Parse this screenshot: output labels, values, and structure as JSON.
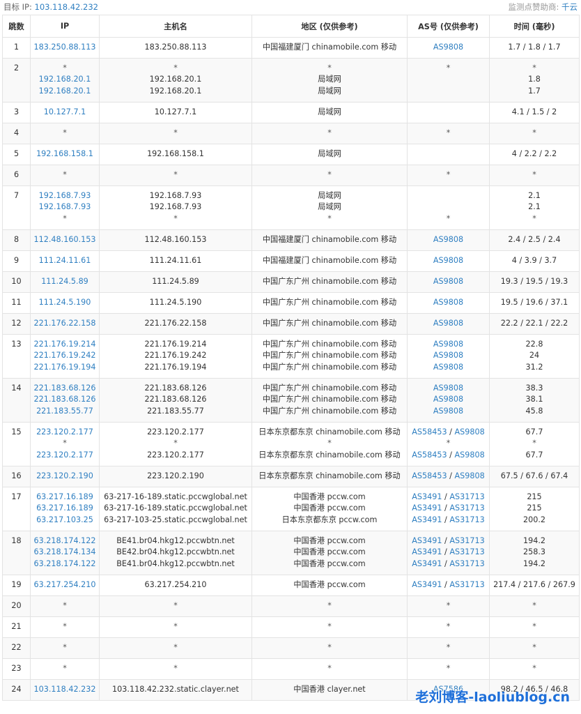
{
  "header": {
    "target_label": "目标 IP:",
    "target_ip": "103.118.42.232",
    "sponsor_label": "监测点赞助商:",
    "sponsor_name": "千云"
  },
  "columns": [
    "跳数",
    "IP",
    "主机名",
    "地区 (仅供参考)",
    "AS号 (仅供参考)",
    "时间 (毫秒)"
  ],
  "rows": [
    {
      "hop": "1",
      "ips": [
        "183.250.88.113"
      ],
      "hosts": [
        "183.250.88.113"
      ],
      "regions": [
        "中国福建厦门 chinamobile.com 移动"
      ],
      "as": [
        [
          "AS9808"
        ]
      ],
      "times": [
        "1.7 / 1.8 / 1.7"
      ]
    },
    {
      "hop": "2",
      "ips": [
        "*",
        "192.168.20.1",
        "192.168.20.1"
      ],
      "hosts": [
        "*",
        "192.168.20.1",
        "192.168.20.1"
      ],
      "regions": [
        "*",
        "局域网",
        "局域网"
      ],
      "as": [
        [
          "*"
        ],
        [],
        []
      ],
      "times": [
        "*",
        "1.8",
        "1.7"
      ]
    },
    {
      "hop": "3",
      "ips": [
        "10.127.7.1"
      ],
      "hosts": [
        "10.127.7.1"
      ],
      "regions": [
        "局域网"
      ],
      "as": [
        []
      ],
      "times": [
        "4.1 / 1.5 / 2"
      ]
    },
    {
      "hop": "4",
      "ips": [
        "*"
      ],
      "hosts": [
        "*"
      ],
      "regions": [
        "*"
      ],
      "as": [
        [
          "*"
        ]
      ],
      "times": [
        "*"
      ]
    },
    {
      "hop": "5",
      "ips": [
        "192.168.158.1"
      ],
      "hosts": [
        "192.168.158.1"
      ],
      "regions": [
        "局域网"
      ],
      "as": [
        []
      ],
      "times": [
        "4 / 2.2 / 2.2"
      ]
    },
    {
      "hop": "6",
      "ips": [
        "*"
      ],
      "hosts": [
        "*"
      ],
      "regions": [
        "*"
      ],
      "as": [
        [
          "*"
        ]
      ],
      "times": [
        "*"
      ]
    },
    {
      "hop": "7",
      "ips": [
        "192.168.7.93",
        "192.168.7.93",
        "*"
      ],
      "hosts": [
        "192.168.7.93",
        "192.168.7.93",
        "*"
      ],
      "regions": [
        "局域网",
        "局域网",
        "*"
      ],
      "as": [
        [],
        [],
        [
          "*"
        ]
      ],
      "times": [
        "2.1",
        "2.1",
        "*"
      ]
    },
    {
      "hop": "8",
      "ips": [
        "112.48.160.153"
      ],
      "hosts": [
        "112.48.160.153"
      ],
      "regions": [
        "中国福建厦门 chinamobile.com 移动"
      ],
      "as": [
        [
          "AS9808"
        ]
      ],
      "times": [
        "2.4 / 2.5 / 2.4"
      ]
    },
    {
      "hop": "9",
      "ips": [
        "111.24.11.61"
      ],
      "hosts": [
        "111.24.11.61"
      ],
      "regions": [
        "中国福建厦门 chinamobile.com 移动"
      ],
      "as": [
        [
          "AS9808"
        ]
      ],
      "times": [
        "4 / 3.9 / 3.7"
      ]
    },
    {
      "hop": "10",
      "ips": [
        "111.24.5.89"
      ],
      "hosts": [
        "111.24.5.89"
      ],
      "regions": [
        "中国广东广州 chinamobile.com 移动"
      ],
      "as": [
        [
          "AS9808"
        ]
      ],
      "times": [
        "19.3 / 19.5 / 19.3"
      ]
    },
    {
      "hop": "11",
      "ips": [
        "111.24.5.190"
      ],
      "hosts": [
        "111.24.5.190"
      ],
      "regions": [
        "中国广东广州 chinamobile.com 移动"
      ],
      "as": [
        [
          "AS9808"
        ]
      ],
      "times": [
        "19.5 / 19.6 / 37.1"
      ]
    },
    {
      "hop": "12",
      "ips": [
        "221.176.22.158"
      ],
      "hosts": [
        "221.176.22.158"
      ],
      "regions": [
        "中国广东广州 chinamobile.com 移动"
      ],
      "as": [
        [
          "AS9808"
        ]
      ],
      "times": [
        "22.2 / 22.1 / 22.2"
      ]
    },
    {
      "hop": "13",
      "ips": [
        "221.176.19.214",
        "221.176.19.242",
        "221.176.19.194"
      ],
      "hosts": [
        "221.176.19.214",
        "221.176.19.242",
        "221.176.19.194"
      ],
      "regions": [
        "中国广东广州 chinamobile.com 移动",
        "中国广东广州 chinamobile.com 移动",
        "中国广东广州 chinamobile.com 移动"
      ],
      "as": [
        [
          "AS9808"
        ],
        [
          "AS9808"
        ],
        [
          "AS9808"
        ]
      ],
      "times": [
        "22.8",
        "24",
        "31.2"
      ]
    },
    {
      "hop": "14",
      "ips": [
        "221.183.68.126",
        "221.183.68.126",
        "221.183.55.77"
      ],
      "hosts": [
        "221.183.68.126",
        "221.183.68.126",
        "221.183.55.77"
      ],
      "regions": [
        "中国广东广州 chinamobile.com 移动",
        "中国广东广州 chinamobile.com 移动",
        "中国广东广州 chinamobile.com 移动"
      ],
      "as": [
        [
          "AS9808"
        ],
        [
          "AS9808"
        ],
        [
          "AS9808"
        ]
      ],
      "times": [
        "38.3",
        "38.1",
        "45.8"
      ]
    },
    {
      "hop": "15",
      "ips": [
        "223.120.2.177",
        "*",
        "223.120.2.177"
      ],
      "hosts": [
        "223.120.2.177",
        "*",
        "223.120.2.177"
      ],
      "regions": [
        "日本东京都东京 chinamobile.com 移动",
        "*",
        "日本东京都东京 chinamobile.com 移动"
      ],
      "as": [
        [
          "AS58453",
          "AS9808"
        ],
        [
          "*"
        ],
        [
          "AS58453",
          "AS9808"
        ]
      ],
      "times": [
        "67.7",
        "*",
        "67.7"
      ]
    },
    {
      "hop": "16",
      "ips": [
        "223.120.2.190"
      ],
      "hosts": [
        "223.120.2.190"
      ],
      "regions": [
        "日本东京都东京 chinamobile.com 移动"
      ],
      "as": [
        [
          "AS58453",
          "AS9808"
        ]
      ],
      "times": [
        "67.5 / 67.6 / 67.4"
      ]
    },
    {
      "hop": "17",
      "ips": [
        "63.217.16.189",
        "63.217.16.189",
        "63.217.103.25"
      ],
      "hosts": [
        "63-217-16-189.static.pccwglobal.net",
        "63-217-16-189.static.pccwglobal.net",
        "63-217-103-25.static.pccwglobal.net"
      ],
      "regions": [
        "中国香港 pccw.com",
        "中国香港 pccw.com",
        "日本东京都东京 pccw.com"
      ],
      "as": [
        [
          "AS3491",
          "AS31713"
        ],
        [
          "AS3491",
          "AS31713"
        ],
        [
          "AS3491",
          "AS31713"
        ]
      ],
      "times": [
        "215",
        "215",
        "200.2"
      ]
    },
    {
      "hop": "18",
      "ips": [
        "63.218.174.122",
        "63.218.174.134",
        "63.218.174.122"
      ],
      "hosts": [
        "BE41.br04.hkg12.pccwbtn.net",
        "BE42.br04.hkg12.pccwbtn.net",
        "BE41.br04.hkg12.pccwbtn.net"
      ],
      "regions": [
        "中国香港 pccw.com",
        "中国香港 pccw.com",
        "中国香港 pccw.com"
      ],
      "as": [
        [
          "AS3491",
          "AS31713"
        ],
        [
          "AS3491",
          "AS31713"
        ],
        [
          "AS3491",
          "AS31713"
        ]
      ],
      "times": [
        "194.2",
        "258.3",
        "194.2"
      ]
    },
    {
      "hop": "19",
      "ips": [
        "63.217.254.210"
      ],
      "hosts": [
        "63.217.254.210"
      ],
      "regions": [
        "中国香港 pccw.com"
      ],
      "as": [
        [
          "AS3491",
          "AS31713"
        ]
      ],
      "times": [
        "217.4 / 217.6 / 267.9"
      ]
    },
    {
      "hop": "20",
      "ips": [
        "*"
      ],
      "hosts": [
        "*"
      ],
      "regions": [
        "*"
      ],
      "as": [
        [
          "*"
        ]
      ],
      "times": [
        "*"
      ]
    },
    {
      "hop": "21",
      "ips": [
        "*"
      ],
      "hosts": [
        "*"
      ],
      "regions": [
        "*"
      ],
      "as": [
        [
          "*"
        ]
      ],
      "times": [
        "*"
      ]
    },
    {
      "hop": "22",
      "ips": [
        "*"
      ],
      "hosts": [
        "*"
      ],
      "regions": [
        "*"
      ],
      "as": [
        [
          "*"
        ]
      ],
      "times": [
        "*"
      ]
    },
    {
      "hop": "23",
      "ips": [
        "*"
      ],
      "hosts": [
        "*"
      ],
      "regions": [
        "*"
      ],
      "as": [
        [
          "*"
        ]
      ],
      "times": [
        "*"
      ]
    },
    {
      "hop": "24",
      "ips": [
        "103.118.42.232"
      ],
      "hosts": [
        "103.118.42.232.static.clayer.net"
      ],
      "regions": [
        "中国香港 clayer.net"
      ],
      "as": [
        [
          "AS7586"
        ]
      ],
      "times": [
        "98.2 / 46.5 / 46.8"
      ]
    }
  ],
  "watermark": "老刘博客-laoliublog.cn",
  "colors": {
    "link": "#2f7fc1",
    "border": "#e3e3e3",
    "row_alt": "#f9f9f9",
    "text": "#333333",
    "watermark": "#1e6fd9"
  }
}
